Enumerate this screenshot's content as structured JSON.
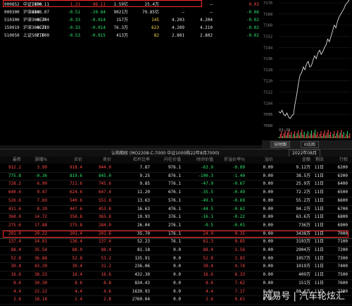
{
  "top_rows": [
    {
      "code": "000852",
      "name": "中证1000",
      "price": "7176.11",
      "chg": "1.21",
      "chgpct": "86.11",
      "vol": "1.59亿",
      "b1": "25.4万",
      "b2": "",
      "b3": "—",
      "b4": "0.03",
      "ccls": "pos",
      "vcls": "wht",
      "b1cls": "wht",
      "b4cls": "pos"
    },
    {
      "code": "000300",
      "name": "沪深300",
      "price": "4148.07",
      "chg": "-0.51",
      "chgpct": "-20.84",
      "vol": "9021万",
      "b1": "79.85亿",
      "b2": "—",
      "b3": "—",
      "b4": "-0.06",
      "ccls": "neg",
      "vcls": "wht",
      "b1cls": "wht",
      "b4cls": "neg"
    },
    {
      "code": "510300",
      "name": "沪深300ETF",
      "price": "4.204",
      "chg": "-0.33",
      "chgpct": "-0.014",
      "vol": "157万",
      "b1": "145",
      "b2": "4.203",
      "b3": "4.204",
      "b4": "-0.02",
      "ccls": "neg",
      "vcls": "wht",
      "b1cls": "yel",
      "b4cls": "neg"
    },
    {
      "code": "159919",
      "name": "沪深300ETF",
      "price": "4.210",
      "chg": "-0.33",
      "chgpct": "-0.014",
      "vol": "76.3万",
      "b1": "623",
      "b2": "4.209",
      "b3": "4.210",
      "b4": "-0.02",
      "ccls": "neg",
      "vcls": "wht",
      "b1cls": "yel",
      "b4cls": "neg"
    },
    {
      "code": "510050",
      "name": "上证50ETF",
      "price": "2.800",
      "chg": "-0.53",
      "chgpct": "-0.015",
      "vol": "413万",
      "b1": "82",
      "b2": "2.801",
      "b3": "2.802",
      "b4": "-0.02",
      "ccls": "neg",
      "vcls": "wht",
      "b1cls": "yel",
      "b4cls": "neg"
    }
  ],
  "chart": {
    "y_ticks": [
      "7176",
      "7168",
      "7160",
      "7152",
      "7144",
      "7136",
      "7128",
      "7120",
      "7112",
      "7104",
      "7096",
      "7088"
    ],
    "price_series": [
      7098,
      7097,
      7099,
      7096,
      7095,
      7097,
      7094,
      7093,
      7095,
      7096,
      7104,
      7110,
      7118,
      7124,
      7126,
      7130,
      7128,
      7132,
      7134,
      7130,
      7131,
      7135,
      7138,
      7136,
      7140,
      7142,
      7139,
      7141,
      7144,
      7146,
      7150,
      7148,
      7152,
      7156,
      7160,
      7158,
      7163,
      7166,
      7168,
      7170,
      7172,
      7175,
      7176,
      7178,
      7180
    ],
    "x_label": "09:30",
    "tabs": [
      "分时图",
      "K线图"
    ]
  },
  "options_header": {
    "left": "认购期权 (MO2208-C-7000  中证1000购22年8月7000)",
    "right": "2022年08月"
  },
  "columns": [
    "最新",
    "涨幅%",
    "买价",
    "卖价",
    "杠杆比率",
    "内在价值",
    "时间价值",
    "折溢价率%",
    "溢价",
    "金额",
    "剩余",
    "行权"
  ],
  "options": [
    {
      "last": "912.2",
      "chgp": "3.99",
      "bid": "918.4",
      "ask": "944.0",
      "lev": "7.87",
      "intr": "976.1",
      "time": "-63.9",
      "prem": "-0.89",
      "implv": "0.00",
      "amt": "9.12万",
      "mon": "11日",
      "strike": "6200"
    },
    {
      "last": "775.8",
      "chgp": "-0.36",
      "bid": "819.6",
      "ask": "845.0",
      "lev": "9.25",
      "intr": "876.1",
      "time": "-100.3",
      "prem": "-1.40",
      "implv": "0.00",
      "amt": "38.5万",
      "mon": "11日",
      "strike": "6300"
    },
    {
      "last": "728.2",
      "chgp": "6.90",
      "bid": "721.6",
      "ask": "745.6",
      "lev": "9.85",
      "intr": "776.1",
      "time": "-47.9",
      "prem": "-0.67",
      "implv": "0.00",
      "amt": "25.9万",
      "mon": "11日",
      "strike": "6400"
    },
    {
      "last": "640.6",
      "chgp": "9.47",
      "bid": "624.6",
      "ask": "647.4",
      "lev": "11.20",
      "intr": "676.1",
      "time": "-35.5",
      "prem": "-0.49",
      "implv": "0.00",
      "amt": "72.2万",
      "mon": "11日",
      "strike": "6500"
    },
    {
      "last": "526.6",
      "chgp": "7.69",
      "bid": "540.6",
      "ask": "551.8",
      "lev": "13.63",
      "intr": "576.1",
      "time": "-49.5",
      "prem": "-0.69",
      "implv": "0.00",
      "amt": "55.2万",
      "mon": "11日",
      "strike": "6600"
    },
    {
      "last": "431.6",
      "chgp": "8.39",
      "bid": "447.6",
      "ask": "453.8",
      "lev": "16.63",
      "intr": "476.1",
      "time": "-44.5",
      "prem": "-0.62",
      "implv": "0.00",
      "amt": "94.2万",
      "mon": "11日",
      "strike": "6700"
    },
    {
      "last": "360.0",
      "chgp": "14.72",
      "bid": "358.8",
      "ask": "365.8",
      "lev": "19.93",
      "intr": "376.1",
      "time": "-16.1",
      "prem": "-0.22",
      "implv": "0.00",
      "amt": "63.6万",
      "mon": "11日",
      "strike": "6800"
    },
    {
      "last": "275.6",
      "chgp": "17.88",
      "bid": "275.8",
      "ask": "284.0",
      "lev": "26.04",
      "intr": "276.1",
      "time": "-0.5",
      "prem": "-0.01",
      "implv": "0.00",
      "amt": "736万",
      "mon": "11日",
      "strike": "6900"
    },
    {
      "last": "201.0",
      "chgp": "20.22",
      "bid": "201.4",
      "ask": "201.6",
      "lev": "35.70",
      "intr": "176.1",
      "time": "24.9",
      "prem": "0.35",
      "implv": "0.00",
      "amt": "3438万",
      "mon": "11日",
      "strike": "7000"
    },
    {
      "last": "137.4",
      "chgp": "24.91",
      "bid": "136.4",
      "ask": "137.4",
      "lev": "52.23",
      "intr": "76.1",
      "time": "61.3",
      "prem": "0.85",
      "implv": "0.00",
      "amt": "3193万",
      "mon": "11日",
      "strike": "7100"
    },
    {
      "last": "88.4",
      "chgp": "35.54",
      "bid": "88.0",
      "ask": "88.4",
      "lev": "81.18",
      "intr": "0.0",
      "time": "88.4",
      "prem": "1.56",
      "implv": "0.00",
      "amt": "2904万",
      "mon": "11日",
      "strike": "7200"
    },
    {
      "last": "52.8",
      "chgp": "36.88",
      "bid": "52.8",
      "ask": "53.2",
      "lev": "135.91",
      "intr": "0.0",
      "time": "52.8",
      "prem": "2.83",
      "implv": "0.00",
      "amt": "1957万",
      "mon": "11日",
      "strike": "7300"
    },
    {
      "last": "30.4",
      "chgp": "43.30",
      "bid": "30.4",
      "ask": "31.2",
      "lev": "236.06",
      "intr": "0.0",
      "time": "30.4",
      "prem": "4.74",
      "implv": "0.00",
      "amt": "1019万",
      "mon": "11日",
      "strike": "7400"
    },
    {
      "last": "16.6",
      "chgp": "38.33",
      "bid": "16.4",
      "ask": "16.6",
      "lev": "432.30",
      "intr": "0.0",
      "time": "16.6",
      "prem": "6.33",
      "implv": "0.00",
      "amt": "409万",
      "mon": "11日",
      "strike": "7500"
    },
    {
      "last": "8.6",
      "chgp": "30.30",
      "bid": "8.6",
      "ask": "8.8",
      "lev": "834.43",
      "intr": "0.0",
      "time": "8.6",
      "prem": "7.62",
      "implv": "0.00",
      "amt": "151万",
      "mon": "11日",
      "strike": "7600"
    },
    {
      "last": "4.4",
      "chgp": "22.22",
      "bid": "4.4",
      "ask": "4.6",
      "lev": "1630.93",
      "intr": "0.0",
      "time": "4.4",
      "prem": "7.17",
      "implv": "0.00",
      "amt": "88.8万",
      "mon": "11日",
      "strike": "7700"
    },
    {
      "last": "2.6",
      "chgp": "18.18",
      "bid": "2.4",
      "ask": "2.8",
      "lev": "2760.04",
      "intr": "0.0",
      "time": "2.6",
      "prem": "9.61",
      "implv": "0.00",
      "amt": "",
      "mon": "",
      "strike": ""
    }
  ],
  "watermark": "汽车轮炫汇",
  "watermark_prefix": "网易号 |"
}
